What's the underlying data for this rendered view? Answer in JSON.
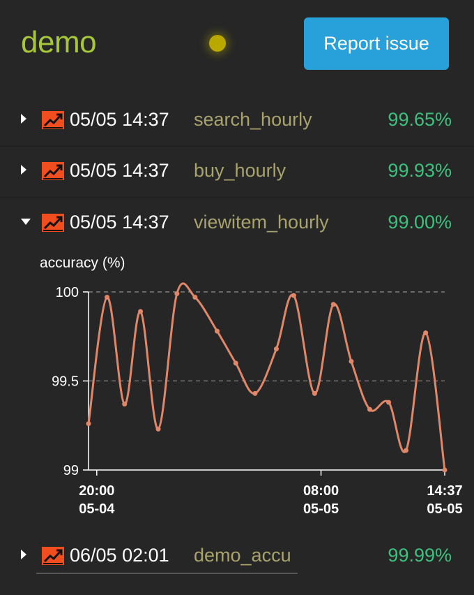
{
  "app": {
    "title": "demo",
    "report_button": "Report issue"
  },
  "rows": [
    {
      "time": "05/05 14:37",
      "name": "search_hourly",
      "pct": "99.65%",
      "expanded": false
    },
    {
      "time": "05/05 14:37",
      "name": "buy_hourly",
      "pct": "99.93%",
      "expanded": false
    },
    {
      "time": "05/05 14:37",
      "name": "viewitem_hourly",
      "pct": "99.00%",
      "expanded": true
    },
    {
      "time": "06/05 02:01",
      "name": "demo_accu",
      "pct": "99.99%",
      "expanded": false
    }
  ],
  "colors": {
    "accent_title": "#a7c63a",
    "button": "#28a0da",
    "pct": "#3ec07d",
    "name": "#a8a26c",
    "line": "#e0876a",
    "indicator": "#b8a800",
    "icon": "#f04e1e"
  },
  "chart_data": {
    "type": "line",
    "ylabel": "accuracy (%)",
    "xlabel": "",
    "ylim": [
      99,
      100
    ],
    "yticks": [
      "100",
      "99.5",
      "99"
    ],
    "xticks": [
      {
        "label": [
          "20:00",
          "05-04"
        ],
        "hour": 0
      },
      {
        "label": [
          "08:00",
          "05-05"
        ],
        "hour": 12
      },
      {
        "label": [
          "14:37",
          "05-05"
        ],
        "hour": 18.62
      }
    ],
    "grid": "dashed horizontal",
    "series": [
      {
        "x": [
          -0.44,
          0.55,
          1.49,
          2.34,
          3.29,
          4.29,
          5.26,
          6.44,
          7.44,
          8.47,
          9.61,
          10.54,
          11.66,
          12.66,
          13.62,
          14.61,
          15.62,
          16.55,
          17.6,
          18.62
        ],
        "y": [
          99.26,
          99.97,
          99.37,
          99.89,
          99.23,
          99.99,
          99.97,
          99.78,
          99.6,
          99.43,
          99.68,
          99.98,
          99.43,
          99.93,
          99.61,
          99.34,
          99.38,
          99.11,
          99.77,
          99.0
        ]
      }
    ]
  }
}
